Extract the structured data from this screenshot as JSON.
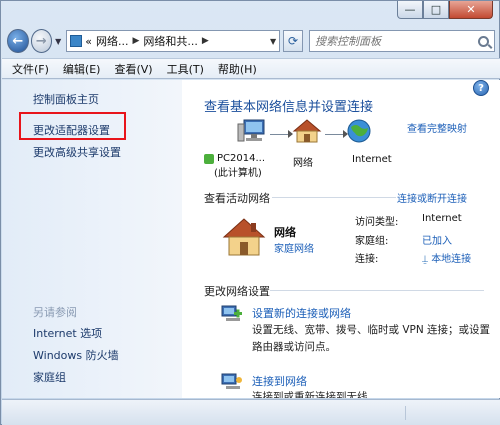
{
  "window": {
    "caption": {
      "minimize": "—",
      "maximize": "□",
      "close": "✕"
    }
  },
  "nav": {
    "back_icon": "back-arrow-icon",
    "forward_icon": "forward-arrow-icon",
    "address": {
      "prefix": "«",
      "crumbs": [
        "网络...",
        "网络和共..."
      ]
    },
    "refresh_glyph": "⟳",
    "search_placeholder": "搜索控制面板"
  },
  "menu": [
    "文件(F)",
    "编辑(E)",
    "查看(V)",
    "工具(T)",
    "帮助(H)"
  ],
  "sidebar": {
    "links": [
      "控制面板主页",
      "更改适配器设置",
      "更改高级共享设置"
    ],
    "see_also_title": "另请参阅",
    "see_also": [
      "Internet 选项",
      "Windows 防火墙",
      "家庭组"
    ]
  },
  "main": {
    "title": "查看基本网络信息并设置连接",
    "view_full_map": "查看完整映射",
    "map": {
      "computer": "PC2014...",
      "computer_sub": "(此计算机)",
      "network": "网络",
      "internet": "Internet"
    },
    "active_head": "查看活动网络",
    "connect_link": "连接或断开连接",
    "active": {
      "name": "网络",
      "type": "家庭网络",
      "props": [
        {
          "label": "访问类型:",
          "value": "Internet"
        },
        {
          "label": "家庭组:",
          "value": "已加入"
        },
        {
          "label": "连接:",
          "value": "本地连接"
        }
      ]
    },
    "change_head": "更改网络设置",
    "tasks": [
      {
        "link": "设置新的连接或网络",
        "desc": "设置无线、宽带、拨号、临时或 VPN 连接；或设置路由器或访问点。"
      },
      {
        "link": "连接到网络",
        "desc": "连接到或重新连接到无线"
      }
    ]
  },
  "colors": {
    "highlight": "#e8141b",
    "link": "#1c5fb8",
    "title": "#1b4f9c"
  }
}
